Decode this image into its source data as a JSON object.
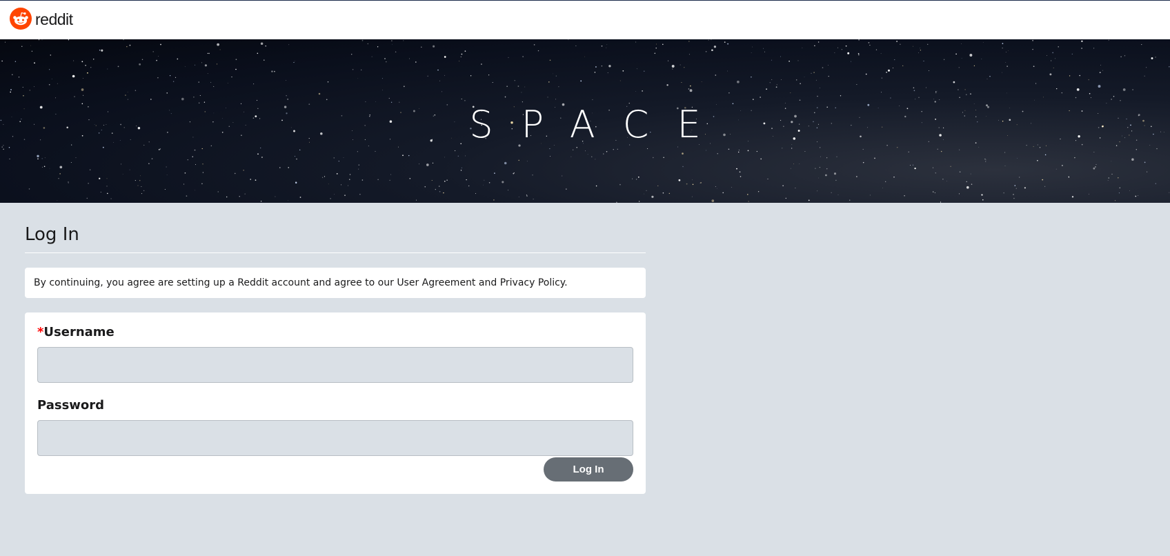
{
  "header": {
    "logo_text": "reddit",
    "logo_icon": "reddit-snoo-icon",
    "brand_color": "#ff4500"
  },
  "banner": {
    "title": "SPACE"
  },
  "login": {
    "title": "Log In",
    "notice": {
      "prefix": "By continuing, you agree are setting up a Reddit account and agree to our ",
      "user_agreement": "User Agreement",
      "and": " and ",
      "privacy_policy": "Privacy Policy",
      "suffix": "."
    },
    "username": {
      "required_mark": "*",
      "label": "Username",
      "value": "",
      "placeholder": ""
    },
    "password": {
      "label": "Password",
      "value": "",
      "placeholder": ""
    },
    "submit_label": "Log In"
  },
  "colors": {
    "page_background": "#dae0e6",
    "button_background": "#676e75",
    "required": "#ff0000"
  }
}
